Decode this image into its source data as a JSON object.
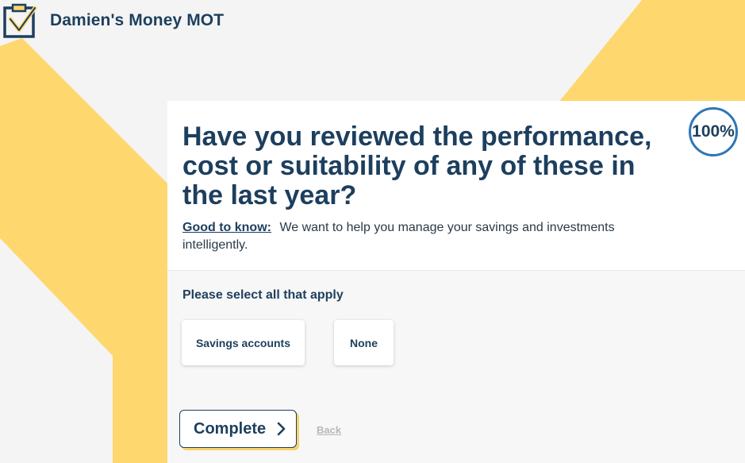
{
  "brand": {
    "title": "Damien's Money MOT",
    "logo_icon": "clipboard-check-icon"
  },
  "question": {
    "title": "Have you reviewed the performance, cost or suitability of any of these in the last year?",
    "progress": "100%",
    "info_label": "Good to know:",
    "info_text": "We want to help you manage your savings and investments intelligently."
  },
  "options": {
    "hint": "Please select all that apply",
    "items": [
      {
        "label": "Savings accounts"
      },
      {
        "label": "None"
      }
    ]
  },
  "actions": {
    "complete_label": "Complete",
    "complete_icon": "chevron-right-icon",
    "back_label": "Back"
  },
  "colors": {
    "brand_navy": "#1d3f5e",
    "accent_yellow": "#fed76f",
    "progress_ring": "#2f76b7",
    "background": "#f4f4f4"
  }
}
